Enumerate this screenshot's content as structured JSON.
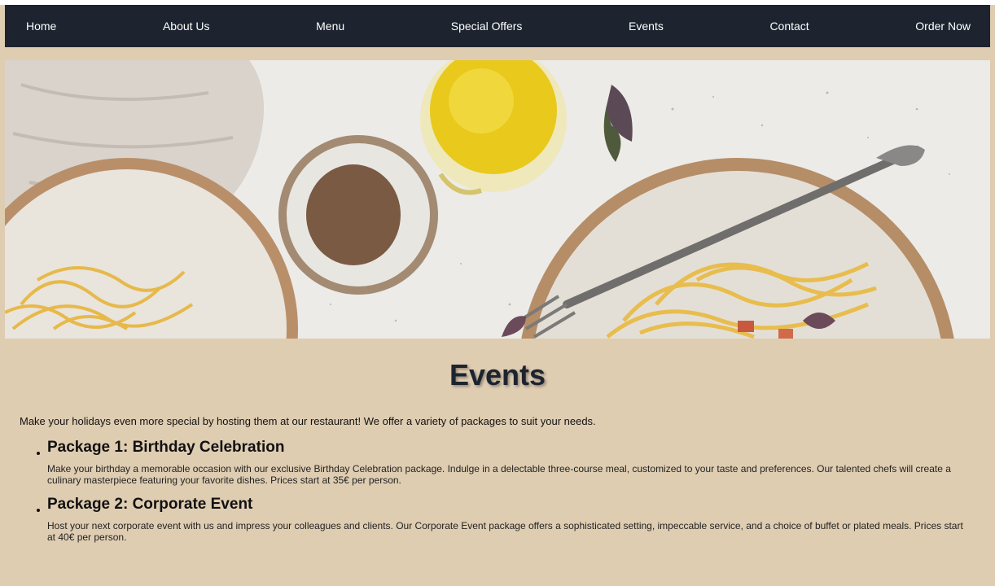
{
  "nav": {
    "items": [
      {
        "label": "Home"
      },
      {
        "label": "About Us"
      },
      {
        "label": "Menu"
      },
      {
        "label": "Special Offers"
      },
      {
        "label": "Events"
      },
      {
        "label": "Contact"
      },
      {
        "label": "Order Now"
      }
    ]
  },
  "page": {
    "title": "Events",
    "intro": "Make your holidays even more special by hosting them at our restaurant! We offer a variety of packages to suit your needs."
  },
  "packages": [
    {
      "title": "Package 1: Birthday Celebration",
      "description": "Make your birthday a memorable occasion with our exclusive Birthday Celebration package. Indulge in a delectable three-course meal, customized to your taste and preferences. Our talented chefs will create a culinary masterpiece featuring your favorite dishes. Prices start at 35€ per person."
    },
    {
      "title": "Package 2: Corporate Event",
      "description": "Host your next corporate event with us and impress your colleagues and clients. Our Corporate Event package offers a sophisticated setting, impeccable service, and a choice of buffet or plated meals. Prices start at 40€ per person."
    }
  ],
  "colors": {
    "navbar": "#1d242f",
    "page_background": "#dfcdb2",
    "title": "#1d242f"
  }
}
